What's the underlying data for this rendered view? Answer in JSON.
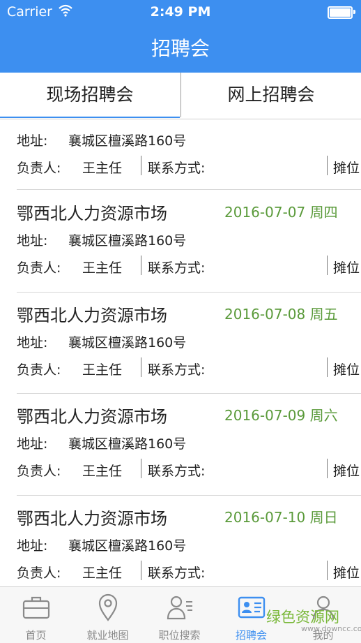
{
  "status_bar": {
    "carrier": "Carrier",
    "time": "2:49 PM"
  },
  "header": {
    "title": "招聘会"
  },
  "tabs": [
    {
      "label": "现场招聘会",
      "active": true
    },
    {
      "label": "网上招聘会",
      "active": false
    }
  ],
  "labels": {
    "address": "地址:",
    "manager": "负责人:",
    "contact": "联系方式:",
    "booth": "摊位"
  },
  "partial_entry": {
    "address": "襄城区檀溪路160号",
    "manager": "王主任"
  },
  "entries": [
    {
      "name": "鄂西北人力资源市场",
      "date": "2016-07-07 周四",
      "address": "襄城区檀溪路160号",
      "manager": "王主任"
    },
    {
      "name": "鄂西北人力资源市场",
      "date": "2016-07-08 周五",
      "address": "襄城区檀溪路160号",
      "manager": "王主任"
    },
    {
      "name": "鄂西北人力资源市场",
      "date": "2016-07-09 周六",
      "address": "襄城区檀溪路160号",
      "manager": "王主任"
    },
    {
      "name": "鄂西北人力资源市场",
      "date": "2016-07-10 周日",
      "address": "襄城区檀溪路160号",
      "manager": "王主任"
    }
  ],
  "tabbar": [
    {
      "label": "首页",
      "icon": "briefcase-icon",
      "active": false
    },
    {
      "label": "就业地图",
      "icon": "map-pin-icon",
      "active": false
    },
    {
      "label": "职位搜索",
      "icon": "person-search-icon",
      "active": false
    },
    {
      "label": "招聘会",
      "icon": "id-card-icon",
      "active": true
    },
    {
      "label": "我的",
      "icon": "user-icon",
      "active": false
    }
  ],
  "watermark": {
    "text": "绿色资源网",
    "url": "www.downcc.com"
  },
  "colors": {
    "brand": "#3d8ff0",
    "date": "#5a9a3a",
    "inactive": "#8a8a8a"
  }
}
